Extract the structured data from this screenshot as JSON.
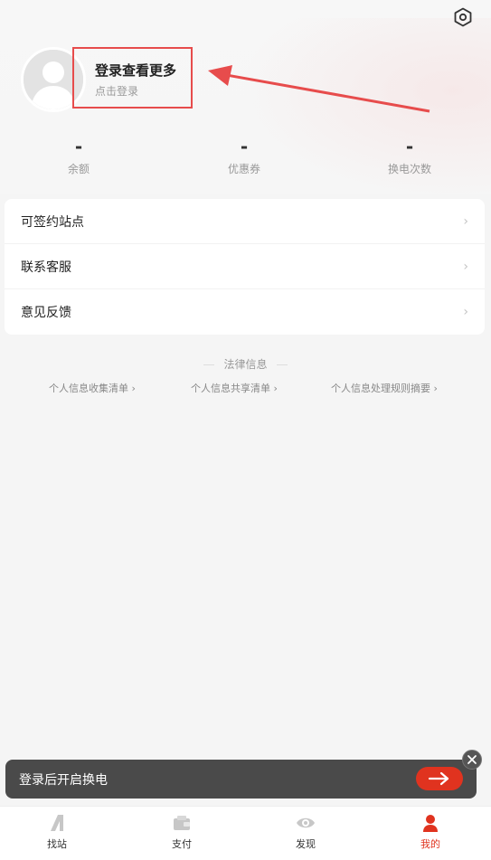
{
  "profile": {
    "title": "登录查看更多",
    "subtitle": "点击登录"
  },
  "stats": [
    {
      "value": "-",
      "label": "余额"
    },
    {
      "value": "-",
      "label": "优惠券"
    },
    {
      "value": "-",
      "label": "换电次数"
    }
  ],
  "menu": [
    {
      "label": "可签约站点",
      "chevron": "›"
    },
    {
      "label": "联系客服",
      "chevron": "›"
    },
    {
      "label": "意见反馈",
      "chevron": "›"
    }
  ],
  "legal": {
    "title": "法律信息",
    "links": [
      "个人信息收集清单 ›",
      "个人信息共享清单 ›",
      "个人信息处理规则摘要 ›"
    ]
  },
  "toast": {
    "text": "登录后开启换电"
  },
  "tabs": [
    {
      "label": "找站",
      "icon": "station-icon"
    },
    {
      "label": "支付",
      "icon": "wallet-icon"
    },
    {
      "label": "发现",
      "icon": "eye-icon"
    },
    {
      "label": "我的",
      "icon": "user-icon"
    }
  ],
  "colors": {
    "accent": "#e0331f",
    "annotation": "#e74c4c"
  }
}
